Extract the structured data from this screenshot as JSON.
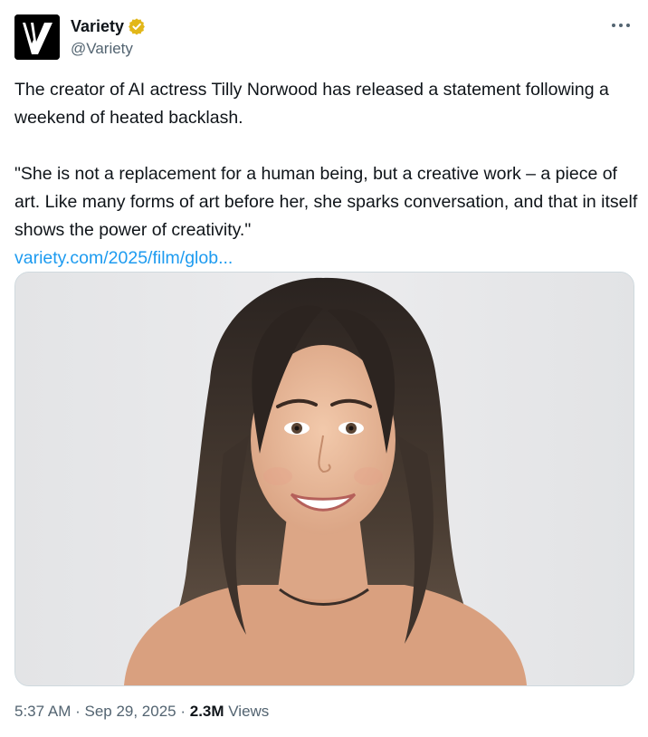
{
  "account": {
    "display_name": "Variety",
    "handle": "@Variety",
    "avatar_letter": "V"
  },
  "tweet": {
    "paragraph1": "The creator of AI actress Tilly Norwood has released a statement following a weekend of heated backlash.",
    "paragraph2": "\"She is not a replacement for a human being, but a creative work – a piece of art. Like many forms of art before her, she sparks conversation, and that in itself shows the power of creativity.\"",
    "link_text": "variety.com/2025/film/glob...",
    "media_icon": "portrait-photo"
  },
  "meta": {
    "time": "5:37 AM",
    "separator1": " · ",
    "date": "Sep 29, 2025",
    "separator2": " · ",
    "views_count": "2.3M",
    "views_label": " Views"
  },
  "icons": {
    "verified": "verified-gold-badge-icon",
    "more": "more-options-icon"
  },
  "colors": {
    "link": "#1d9bf0",
    "secondary_text": "#536471",
    "primary_text": "#0f1419",
    "verified_gold": "#e2b719",
    "border": "#cfd9de"
  }
}
